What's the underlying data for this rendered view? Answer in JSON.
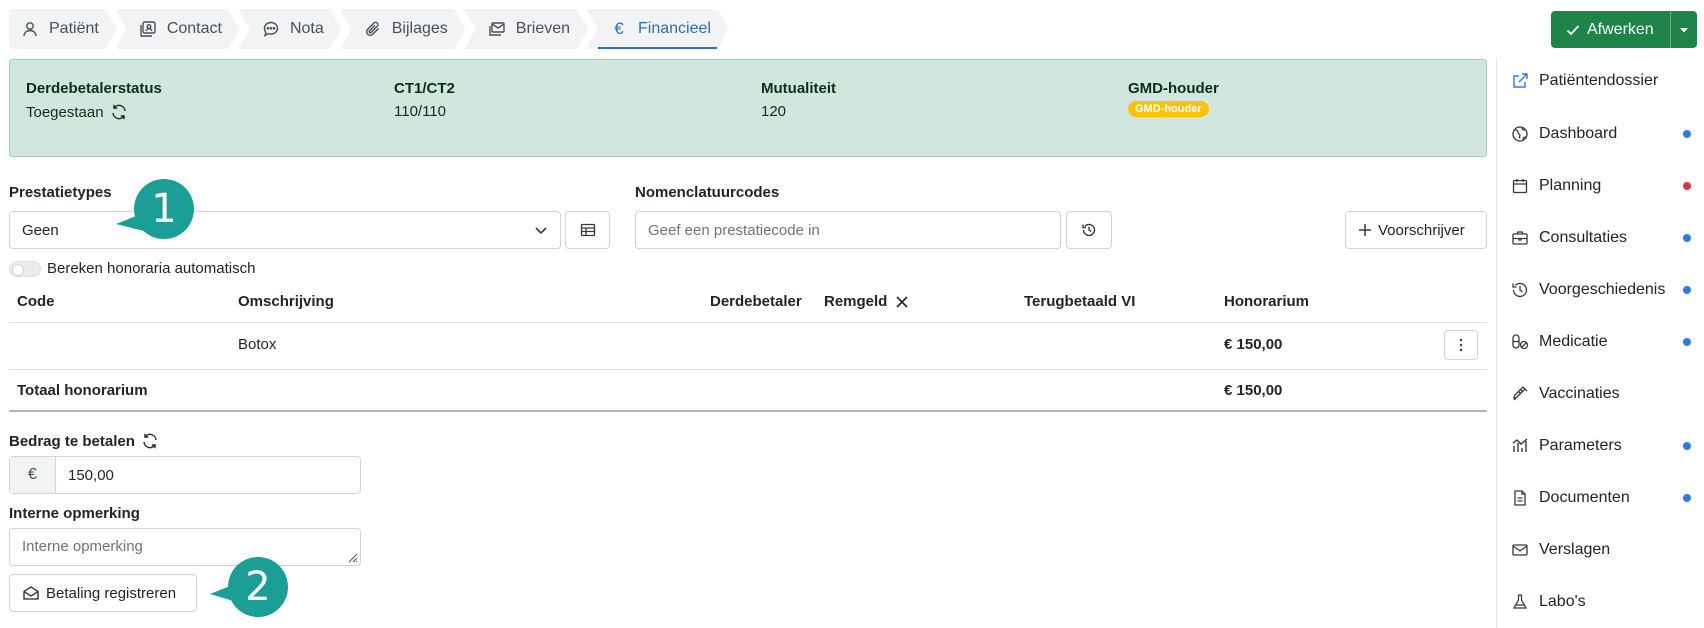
{
  "tabs": [
    {
      "label": "Patiënt",
      "icon": "person-icon"
    },
    {
      "label": "Contact",
      "icon": "contact-card-icon"
    },
    {
      "label": "Nota",
      "icon": "chat-bubble-icon"
    },
    {
      "label": "Bijlages",
      "icon": "paperclip-icon"
    },
    {
      "label": "Brieven",
      "icon": "letters-icon"
    },
    {
      "label": "Financieel",
      "icon": "euro-icon",
      "active": true
    }
  ],
  "afwerken": {
    "label": "Afwerken",
    "color": "#1e8449"
  },
  "info": {
    "derdebetaler_label": "Derdebetalerstatus",
    "derdebetaler_value": "Toegestaan",
    "ct_label": "CT1/CT2",
    "ct_value": "110/110",
    "mut_label": "Mutualiteit",
    "mut_value": "120",
    "gmd_label": "GMD-houder",
    "gmd_badge": "GMD-houder",
    "bg_color": "#d1e7dd"
  },
  "form": {
    "prestatietypes_label": "Prestatietypes",
    "prestatietypes_value": "Geen",
    "nomenclatuur_label": "Nomenclatuurcodes",
    "nomenclatuur_placeholder": "Geef een prestatiecode in",
    "voorschrijver_label": "Voorschrijver",
    "auto_label": "Bereken honoraria automatisch"
  },
  "table": {
    "headers": {
      "code": "Code",
      "omschrijving": "Omschrijving",
      "derdebetaler": "Derdebetaler",
      "remgeld": "Remgeld",
      "terugbetaald": "Terugbetaald VI",
      "honorarium": "Honorarium"
    },
    "rows": [
      {
        "code": "",
        "omschrijving": "Botox",
        "honorarium": "€ 150,00"
      }
    ],
    "total_label": "Totaal honorarium",
    "total_value": "€ 150,00"
  },
  "payment": {
    "bedrag_label": "Bedrag te betalen",
    "currency": "€",
    "amount": "150,00",
    "opmerking_label": "Interne opmerking",
    "opmerking_placeholder": "Interne opmerking",
    "register_label": "Betaling registreren"
  },
  "callouts": [
    "1",
    "2"
  ],
  "sidebar": [
    {
      "label": "Patiëntendossier",
      "icon": "external-link-icon",
      "dot": null
    },
    {
      "label": "Dashboard",
      "icon": "globe-icon",
      "dot": "#2c7be5"
    },
    {
      "label": "Planning",
      "icon": "calendar-icon",
      "dot": "#dc3545"
    },
    {
      "label": "Consultaties",
      "icon": "briefcase-icon",
      "dot": "#2c7be5"
    },
    {
      "label": "Voorgeschiedenis",
      "icon": "history-icon",
      "dot": "#2c7be5"
    },
    {
      "label": "Medicatie",
      "icon": "pills-icon",
      "dot": "#2c7be5"
    },
    {
      "label": "Vaccinaties",
      "icon": "syringe-icon",
      "dot": null
    },
    {
      "label": "Parameters",
      "icon": "chart-icon",
      "dot": "#2c7be5"
    },
    {
      "label": "Documenten",
      "icon": "document-icon",
      "dot": "#2c7be5"
    },
    {
      "label": "Verslagen",
      "icon": "envelope-icon",
      "dot": null
    },
    {
      "label": "Labo's",
      "icon": "flask-icon",
      "dot": null
    }
  ]
}
